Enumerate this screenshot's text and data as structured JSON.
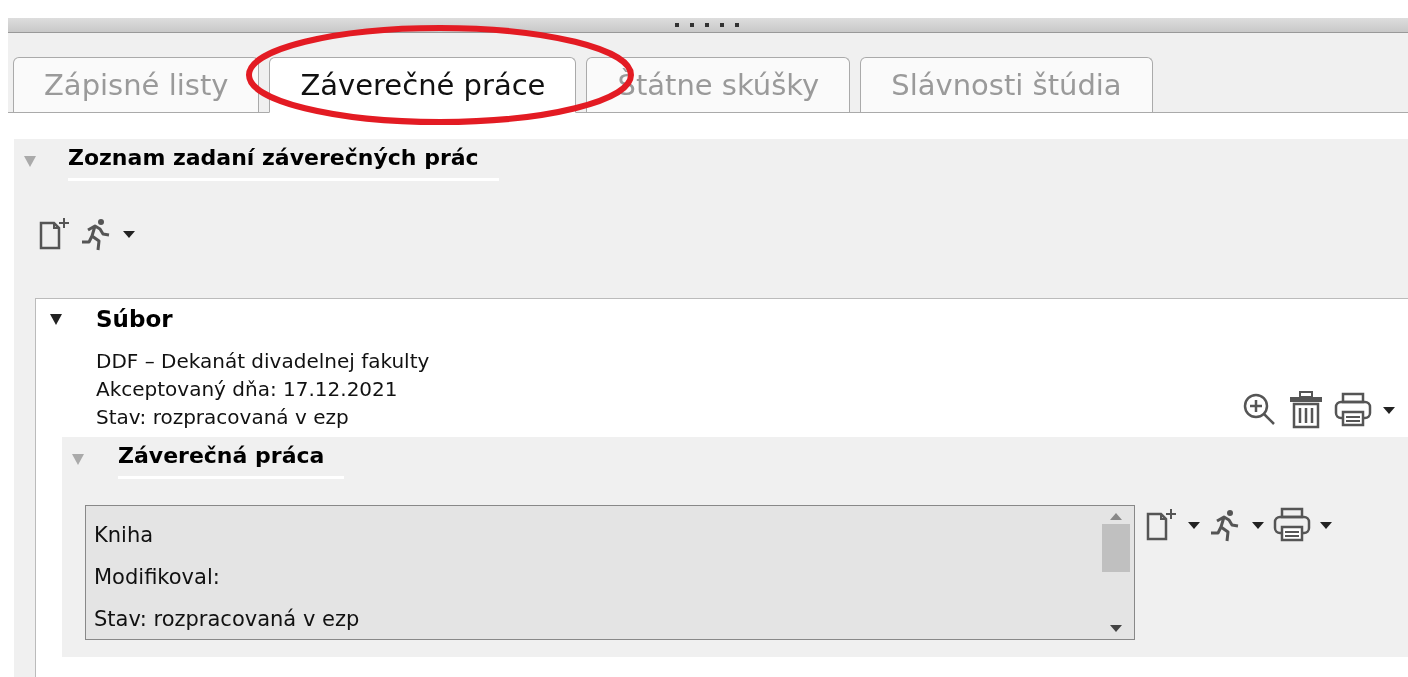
{
  "tabs": [
    {
      "label": "Zápisné listy",
      "selected": false
    },
    {
      "label": "Záverečné práce",
      "selected": true
    },
    {
      "label": "Štátne skúšky",
      "selected": false
    },
    {
      "label": "Slávnosti štúdia",
      "selected": false
    }
  ],
  "section": {
    "title": "Zoznam zadaní záverečných prác",
    "expanded": true,
    "file": {
      "title": "Súbor",
      "expanded": true,
      "lines": [
        "DDF – Dekanát divadelnej fakulty",
        "Akceptovaný dňa: 17.12.2021",
        "Stav: rozpracovaná v ezp"
      ],
      "thesis": {
        "title": "Záverečná práca",
        "expanded": true,
        "list": [
          "Kniha",
          "Modifikoval:",
          "Stav: rozpracovaná v ezp"
        ]
      }
    }
  }
}
